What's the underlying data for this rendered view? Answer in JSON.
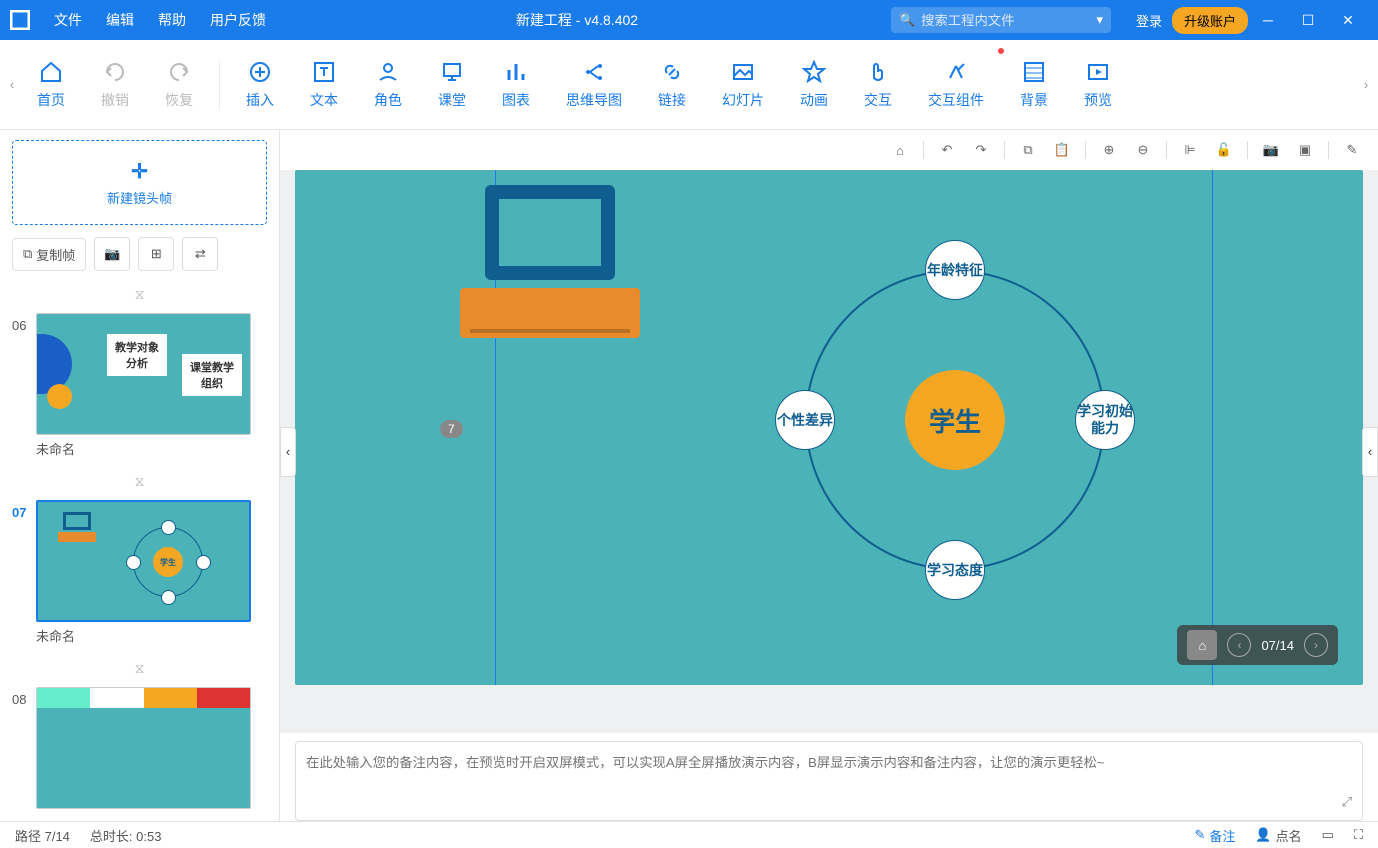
{
  "titlebar": {
    "menus": [
      "文件",
      "编辑",
      "帮助",
      "用户反馈"
    ],
    "title": "新建工程 - v4.8.402",
    "search_placeholder": "搜索工程内文件",
    "login": "登录",
    "upgrade": "升级账户"
  },
  "ribbon": {
    "items": [
      {
        "id": "home",
        "label": "首页",
        "disabled": false
      },
      {
        "id": "undo",
        "label": "撤销",
        "disabled": true
      },
      {
        "id": "redo",
        "label": "恢复",
        "disabled": true
      },
      {
        "id": "insert",
        "label": "插入"
      },
      {
        "id": "text",
        "label": "文本"
      },
      {
        "id": "role",
        "label": "角色"
      },
      {
        "id": "class",
        "label": "课堂"
      },
      {
        "id": "chart",
        "label": "图表"
      },
      {
        "id": "mindmap",
        "label": "思维导图"
      },
      {
        "id": "link",
        "label": "链接"
      },
      {
        "id": "slide",
        "label": "幻灯片"
      },
      {
        "id": "anim",
        "label": "动画"
      },
      {
        "id": "interact",
        "label": "交互"
      },
      {
        "id": "widget",
        "label": "交互组件",
        "dot": true
      },
      {
        "id": "bg",
        "label": "背景"
      },
      {
        "id": "preview",
        "label": "预览"
      }
    ]
  },
  "sidebar": {
    "new_frame": "新建镜头帧",
    "copy_frame": "复制帧",
    "slides": [
      {
        "num": "06",
        "name": "未命名",
        "card1": "教学对象分析",
        "card2": "课堂教学组织"
      },
      {
        "num": "07",
        "name": "未命名",
        "active": true,
        "mini_center": "学生"
      },
      {
        "num": "08",
        "name": ""
      }
    ]
  },
  "canvas": {
    "center": "学生",
    "nodes": {
      "top": "年龄特征",
      "left": "个性差异",
      "right": "学习初始能力",
      "bottom": "学习态度"
    },
    "indicator": "7",
    "nav_counter": "07/14"
  },
  "notes": {
    "placeholder": "在此处输入您的备注内容，在预览时开启双屏模式，可以实现A屏全屏播放演示内容，B屏显示演示内容和备注内容，让您的演示更轻松~"
  },
  "statusbar": {
    "path": "路径 7/14",
    "duration": "总时长: 0:53",
    "notes": "备注",
    "rollcall": "点名"
  }
}
